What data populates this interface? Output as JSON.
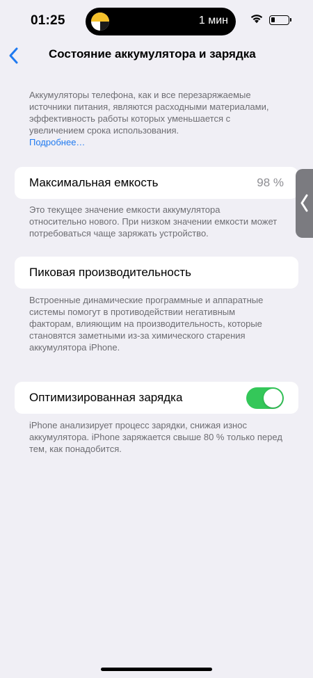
{
  "status_bar": {
    "time": "01:25",
    "island_text": "1 мин",
    "icons": [
      "island-app-icon",
      "wifi-icon",
      "battery-icon"
    ]
  },
  "nav": {
    "back_icon": "chevron-left-icon",
    "title": "Состояние аккумулятора и зарядка"
  },
  "intro": {
    "text": "Аккумуляторы телефона, как и все перезаряжаемые источники питания, являются расходными материалами, эффективность работы которых уменьшается с увеличением срока использования.",
    "link": "Подробнее…"
  },
  "max_capacity": {
    "label": "Максимальная емкость",
    "value": "98 %",
    "note": "Это текущее значение емкости аккумулятора относительно нового. При низком значении емкости может потребоваться чаще заряжать устройство."
  },
  "peak_performance": {
    "label": "Пиковая производительность",
    "note": "Встроенные динамические программные и аппаратные системы помогут в противодействии негативным факторам, влияющим на производительность, которые становятся заметными из-за химического старения аккумулятора iPhone."
  },
  "optimized_charging": {
    "label": "Оптимизированная зарядка",
    "enabled": true,
    "note": "iPhone анализирует процесс зарядки, снижая износ аккумулятора. iPhone заряжается свыше 80 % только перед тем, как понадобится."
  },
  "colors": {
    "background": "#f0eff5",
    "accent": "#1f7af0",
    "toggle_on": "#34c759",
    "secondary_text": "#6d6d72"
  }
}
